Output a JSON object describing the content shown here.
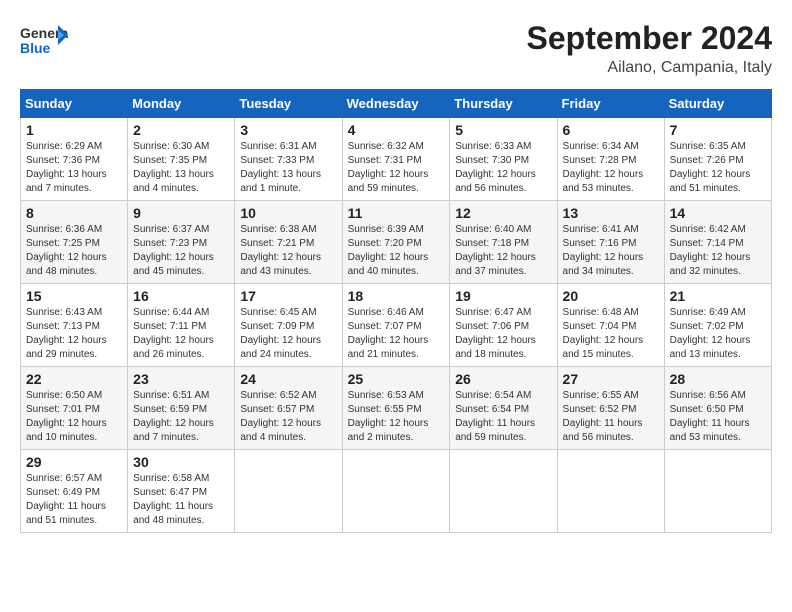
{
  "logo": {
    "general": "General",
    "blue": "Blue"
  },
  "header": {
    "month": "September 2024",
    "location": "Ailano, Campania, Italy"
  },
  "columns": [
    "Sunday",
    "Monday",
    "Tuesday",
    "Wednesday",
    "Thursday",
    "Friday",
    "Saturday"
  ],
  "weeks": [
    [
      {
        "day": "1",
        "info": "Sunrise: 6:29 AM\nSunset: 7:36 PM\nDaylight: 13 hours and 7 minutes."
      },
      {
        "day": "2",
        "info": "Sunrise: 6:30 AM\nSunset: 7:35 PM\nDaylight: 13 hours and 4 minutes."
      },
      {
        "day": "3",
        "info": "Sunrise: 6:31 AM\nSunset: 7:33 PM\nDaylight: 13 hours and 1 minute."
      },
      {
        "day": "4",
        "info": "Sunrise: 6:32 AM\nSunset: 7:31 PM\nDaylight: 12 hours and 59 minutes."
      },
      {
        "day": "5",
        "info": "Sunrise: 6:33 AM\nSunset: 7:30 PM\nDaylight: 12 hours and 56 minutes."
      },
      {
        "day": "6",
        "info": "Sunrise: 6:34 AM\nSunset: 7:28 PM\nDaylight: 12 hours and 53 minutes."
      },
      {
        "day": "7",
        "info": "Sunrise: 6:35 AM\nSunset: 7:26 PM\nDaylight: 12 hours and 51 minutes."
      }
    ],
    [
      {
        "day": "8",
        "info": "Sunrise: 6:36 AM\nSunset: 7:25 PM\nDaylight: 12 hours and 48 minutes."
      },
      {
        "day": "9",
        "info": "Sunrise: 6:37 AM\nSunset: 7:23 PM\nDaylight: 12 hours and 45 minutes."
      },
      {
        "day": "10",
        "info": "Sunrise: 6:38 AM\nSunset: 7:21 PM\nDaylight: 12 hours and 43 minutes."
      },
      {
        "day": "11",
        "info": "Sunrise: 6:39 AM\nSunset: 7:20 PM\nDaylight: 12 hours and 40 minutes."
      },
      {
        "day": "12",
        "info": "Sunrise: 6:40 AM\nSunset: 7:18 PM\nDaylight: 12 hours and 37 minutes."
      },
      {
        "day": "13",
        "info": "Sunrise: 6:41 AM\nSunset: 7:16 PM\nDaylight: 12 hours and 34 minutes."
      },
      {
        "day": "14",
        "info": "Sunrise: 6:42 AM\nSunset: 7:14 PM\nDaylight: 12 hours and 32 minutes."
      }
    ],
    [
      {
        "day": "15",
        "info": "Sunrise: 6:43 AM\nSunset: 7:13 PM\nDaylight: 12 hours and 29 minutes."
      },
      {
        "day": "16",
        "info": "Sunrise: 6:44 AM\nSunset: 7:11 PM\nDaylight: 12 hours and 26 minutes."
      },
      {
        "day": "17",
        "info": "Sunrise: 6:45 AM\nSunset: 7:09 PM\nDaylight: 12 hours and 24 minutes."
      },
      {
        "day": "18",
        "info": "Sunrise: 6:46 AM\nSunset: 7:07 PM\nDaylight: 12 hours and 21 minutes."
      },
      {
        "day": "19",
        "info": "Sunrise: 6:47 AM\nSunset: 7:06 PM\nDaylight: 12 hours and 18 minutes."
      },
      {
        "day": "20",
        "info": "Sunrise: 6:48 AM\nSunset: 7:04 PM\nDaylight: 12 hours and 15 minutes."
      },
      {
        "day": "21",
        "info": "Sunrise: 6:49 AM\nSunset: 7:02 PM\nDaylight: 12 hours and 13 minutes."
      }
    ],
    [
      {
        "day": "22",
        "info": "Sunrise: 6:50 AM\nSunset: 7:01 PM\nDaylight: 12 hours and 10 minutes."
      },
      {
        "day": "23",
        "info": "Sunrise: 6:51 AM\nSunset: 6:59 PM\nDaylight: 12 hours and 7 minutes."
      },
      {
        "day": "24",
        "info": "Sunrise: 6:52 AM\nSunset: 6:57 PM\nDaylight: 12 hours and 4 minutes."
      },
      {
        "day": "25",
        "info": "Sunrise: 6:53 AM\nSunset: 6:55 PM\nDaylight: 12 hours and 2 minutes."
      },
      {
        "day": "26",
        "info": "Sunrise: 6:54 AM\nSunset: 6:54 PM\nDaylight: 11 hours and 59 minutes."
      },
      {
        "day": "27",
        "info": "Sunrise: 6:55 AM\nSunset: 6:52 PM\nDaylight: 11 hours and 56 minutes."
      },
      {
        "day": "28",
        "info": "Sunrise: 6:56 AM\nSunset: 6:50 PM\nDaylight: 11 hours and 53 minutes."
      }
    ],
    [
      {
        "day": "29",
        "info": "Sunrise: 6:57 AM\nSunset: 6:49 PM\nDaylight: 11 hours and 51 minutes."
      },
      {
        "day": "30",
        "info": "Sunrise: 6:58 AM\nSunset: 6:47 PM\nDaylight: 11 hours and 48 minutes."
      },
      null,
      null,
      null,
      null,
      null
    ]
  ]
}
